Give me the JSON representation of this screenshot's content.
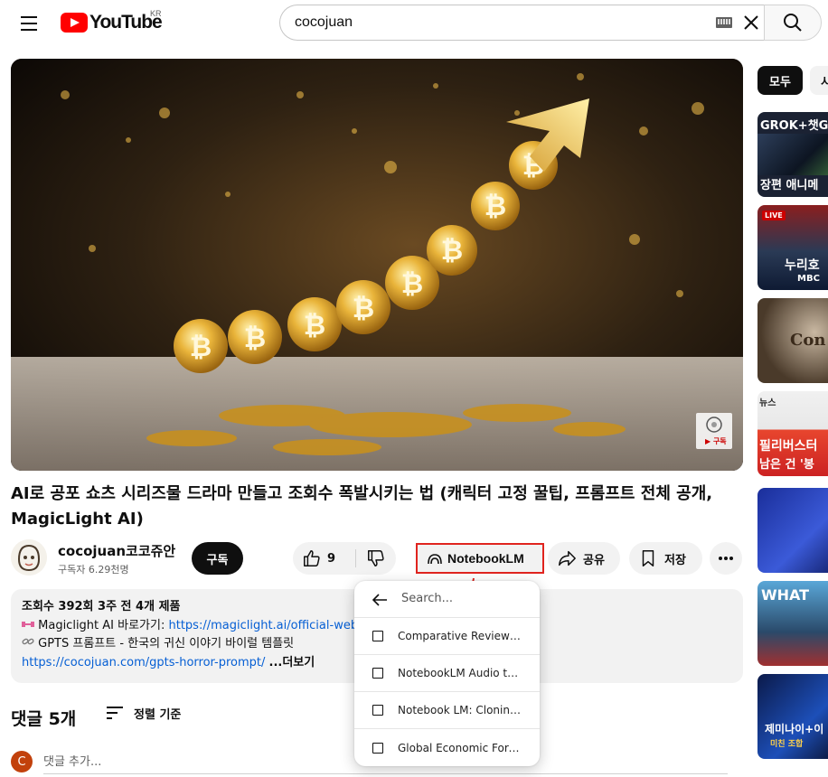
{
  "header": {
    "logo_text": "YouTube",
    "country_code": "KR",
    "search_value": "cocojuan"
  },
  "player": {
    "watermark_label": "▶ 구독"
  },
  "video": {
    "title": "AI로 공포 쇼츠 시리즈물 드라마 만들고 조회수 폭발시키는 법 (캐릭터 고정 꿀팁, 프롬프트 전체 공개, MagicLight AI)",
    "channel_name": "cocojuan코코쥬안",
    "subscriber_count": "구독자 6.29천명",
    "subscribe_label": "구독",
    "like_count": "9",
    "notebooklm_label": "NotebookLM",
    "share_label": "공유",
    "save_label": "저장"
  },
  "description": {
    "meta": "조회수 392회  3주 전  4개 제품",
    "line1_prefix": "Magiclight AI 바로가기: ",
    "line1_link": "https://magiclight.ai/official-web",
    "line2_prefix": "GPTS 프롬프트 - 한국의 귀신 이야기 바이럴 템플릿",
    "line3_link": "https://cocojuan.com/gpts-horror-prompt/",
    "more_label": "...더보기"
  },
  "comments": {
    "title": "댓글 5개",
    "sort_label": "정렬 기준",
    "avatar_letter": "C",
    "add_placeholder": "댓글 추가..."
  },
  "dropdown": {
    "search_placeholder": "Search...",
    "items": [
      {
        "label": "Comparative Reviews of AI Video Tools"
      },
      {
        "label": "NotebookLM Audio to Video Guide"
      },
      {
        "label": "Notebook LM: Cloning Your Voice"
      },
      {
        "label": "Global Economic Forecast"
      }
    ]
  },
  "sidebar": {
    "chips": [
      {
        "label": "모두"
      },
      {
        "label": "시"
      }
    ],
    "thumbnails": [
      {
        "text_top": "GROK+챗GPT",
        "text_bottom": "장편 애니메",
        "live": ""
      },
      {
        "text_top": "",
        "text_bottom": "누리호",
        "text_extra": "MBC",
        "live": "LIVE"
      },
      {
        "text_top": "",
        "text_bottom": "Con",
        "live": ""
      },
      {
        "text_top": "뉴스",
        "text_bottom": "필리버스터",
        "text_extra": "남은 건 '봉",
        "live": ""
      },
      {
        "text_top": "",
        "text_bottom": "",
        "live": ""
      },
      {
        "text_top": "WHAT",
        "text_bottom": "",
        "live": ""
      },
      {
        "text_top": "",
        "text_bottom": "제미나이+이",
        "text_extra": "미친 조합",
        "live": ""
      }
    ]
  },
  "colors": {
    "youtube_red": "#ff0000",
    "annotation_red": "#e0241f",
    "link_blue": "#065fd4"
  }
}
